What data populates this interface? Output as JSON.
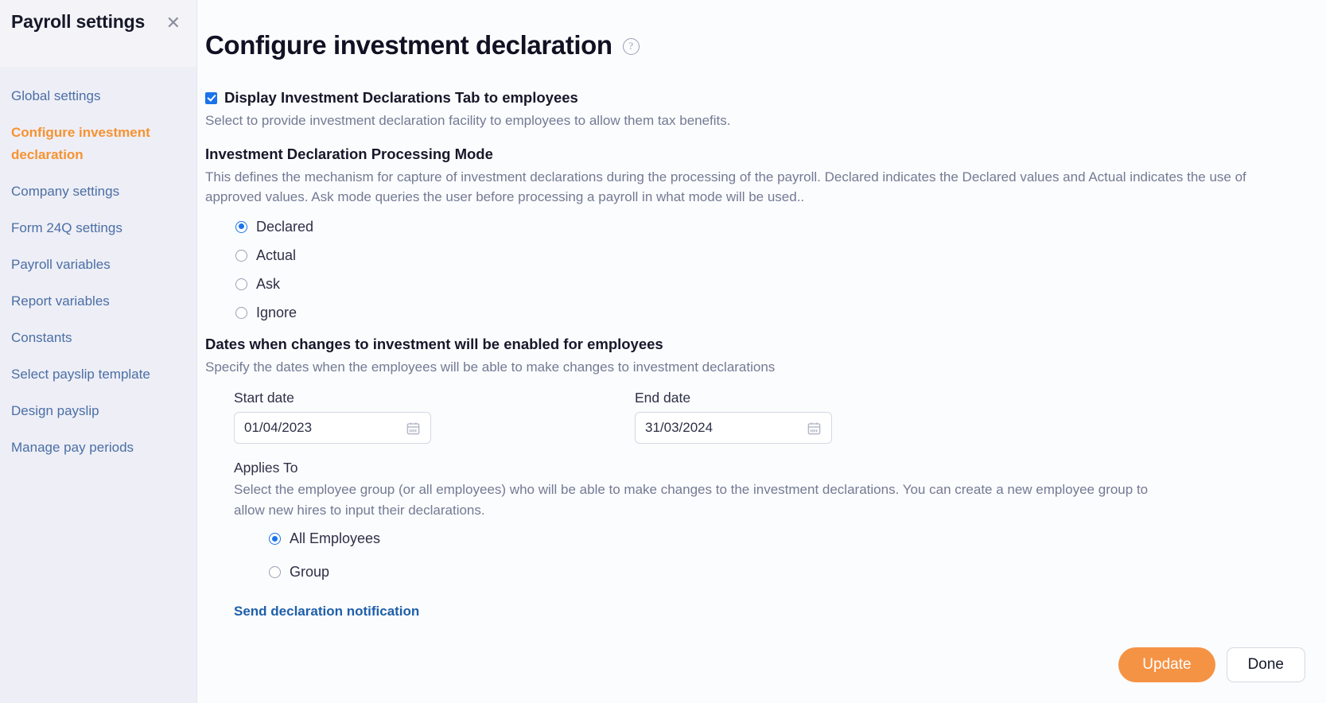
{
  "sidebar": {
    "title": "Payroll settings",
    "close_icon": "close-icon",
    "items": [
      {
        "label": "Global settings",
        "active": false
      },
      {
        "label": "Configure investment declaration",
        "active": true
      },
      {
        "label": "Company settings",
        "active": false
      },
      {
        "label": "Form 24Q settings",
        "active": false
      },
      {
        "label": "Payroll variables",
        "active": false
      },
      {
        "label": "Report variables",
        "active": false
      },
      {
        "label": "Constants",
        "active": false
      },
      {
        "label": "Select payslip template",
        "active": false
      },
      {
        "label": "Design payslip",
        "active": false
      },
      {
        "label": "Manage pay periods",
        "active": false
      }
    ]
  },
  "main": {
    "title": "Configure investment declaration",
    "help_icon": "?",
    "display_tab": {
      "checked": true,
      "label": "Display Investment Declarations Tab to employees",
      "description": "Select to provide investment declaration facility to employees to allow them tax benefits."
    },
    "processing_mode": {
      "heading": "Investment Declaration Processing Mode",
      "description": "This defines the mechanism for capture of investment declarations during the processing of the payroll. Declared indicates the Declared values and Actual indicates the use of approved values. Ask mode queries the user before processing a payroll in what mode will be used..",
      "options": [
        {
          "label": "Declared",
          "selected": true
        },
        {
          "label": "Actual",
          "selected": false
        },
        {
          "label": "Ask",
          "selected": false
        },
        {
          "label": "Ignore",
          "selected": false
        }
      ]
    },
    "dates": {
      "heading": "Dates when changes to investment will be enabled for employees",
      "description": "Specify the dates when the employees will be able to make changes to investment declarations",
      "start_label": "Start date",
      "start_value": "01/04/2023",
      "end_label": "End date",
      "end_value": "31/03/2024"
    },
    "applies_to": {
      "heading": "Applies To",
      "description": "Select the employee group (or all employees) who will be able to make changes to the investment declarations. You can create a new employee group to allow new hires to input their declarations.",
      "options": [
        {
          "label": "All Employees",
          "selected": true
        },
        {
          "label": "Group",
          "selected": false
        }
      ]
    },
    "notification_link": "Send declaration notification",
    "footer": {
      "update_label": "Update",
      "done_label": "Done"
    }
  },
  "colors": {
    "accent_orange": "#f59331",
    "link_blue": "#4a6fa5",
    "radio_blue": "#1a73e8",
    "button_orange": "#f59345"
  }
}
